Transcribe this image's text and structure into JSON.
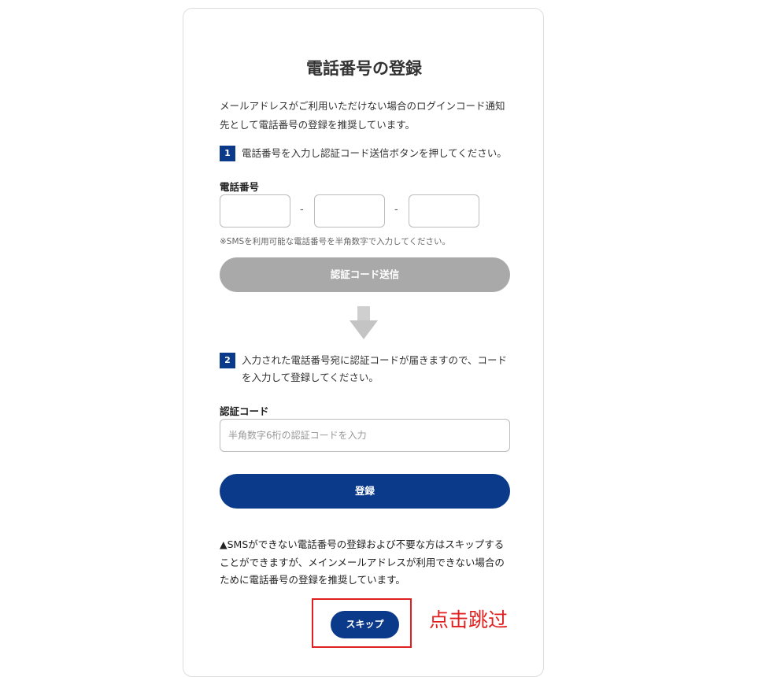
{
  "page": {
    "title": "電話番号の登録",
    "intro": "メールアドレスがご利用いただけない場合のログインコード通知先として電話番号の登録を推奨しています。"
  },
  "step1": {
    "number": "1",
    "text": "電話番号を入力し認証コード送信ボタンを押してください。",
    "phone_label": "電話番号",
    "separator": "-",
    "note": "※SMSを利用可能な電話番号を半角数字で入力してください。",
    "send_button": "認証コード送信"
  },
  "step2": {
    "number": "2",
    "text": "入力された電話番号宛に認証コードが届きますので、コードを入力して登録してください。",
    "code_label": "認証コード",
    "code_placeholder": "半角数字6桁の認証コードを入力",
    "register_button": "登録"
  },
  "warning": {
    "text": "▲SMSができない電話番号の登録および不要な方はスキップすることができますが、メインメールアドレスが利用できない場合のために電話番号の登録を推奨しています。"
  },
  "skip_button": "スキップ",
  "annotation": "点击跳过",
  "colors": {
    "primary": "#0b3a8a",
    "disabled": "#a9a9a9",
    "annotation_red": "#e02020"
  },
  "icons": {
    "down_arrow": "down-arrow-icon"
  }
}
